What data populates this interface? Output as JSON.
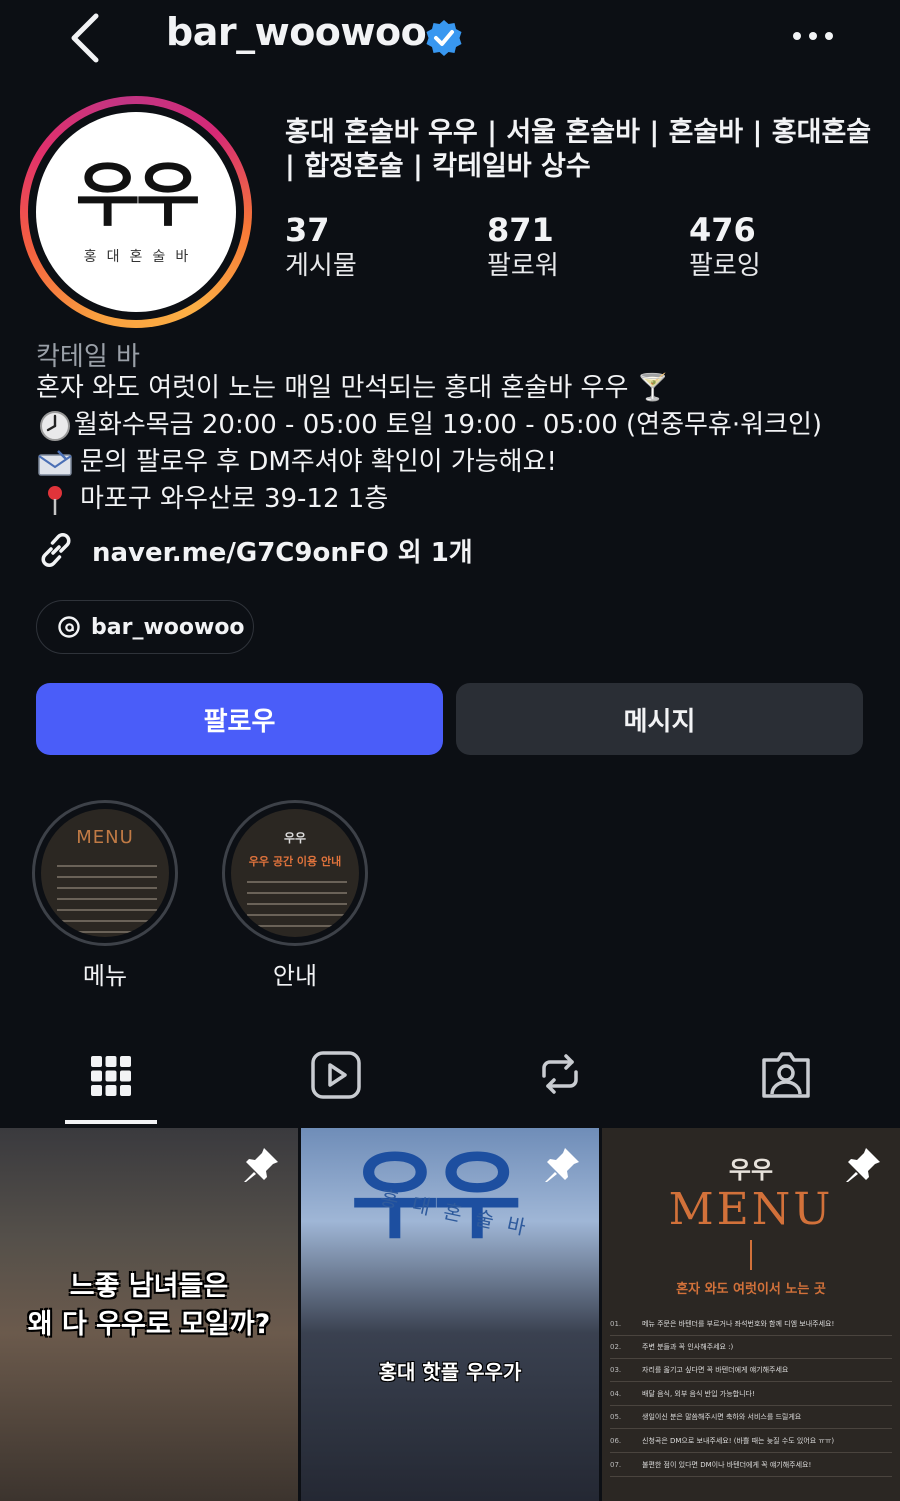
{
  "header": {
    "username": "bar_woowoo"
  },
  "profile": {
    "avatar_logo": "우우",
    "avatar_sub": "홍대혼술바",
    "full_name": "홍대 혼술바 우우 | 서울 혼술바 | 혼술바 | 홍대혼술 | 합정혼술 | 칵테일바 상수",
    "stats": [
      {
        "num": "37",
        "label": "게시물"
      },
      {
        "num": "871",
        "label": "팔로워"
      },
      {
        "num": "476",
        "label": "팔로잉"
      }
    ],
    "category": "칵테일 바",
    "bio_lines": [
      "혼자 와도 여럿이 노는 매일 만석되는 홍대 혼술바 우우 🍸",
      "월화수목금 20:00 - 05:00 토일 19:00 - 05:00 (연중무휴·워크인)",
      "문의 팔로우 후 DM주셔야 확인이 가능해요!",
      "마포구 와우산로 39-12 1층"
    ],
    "link": "naver.me/G7C9onFO 외 1개",
    "threads_handle": "bar_woowoo"
  },
  "actions": {
    "follow": "팔로우",
    "message": "메시지"
  },
  "highlights": [
    {
      "label": "메뉴",
      "cover_title": "MENU"
    },
    {
      "label": "안내",
      "cover_top": "우우",
      "cover_title": "우우 공간 이용 안내"
    }
  ],
  "posts": [
    {
      "text_line1": "느좋 남녀들은",
      "text_line2": "왜 다 우우로 모일까?",
      "pinned": true
    },
    {
      "logo": "우우",
      "sub": "홍대혼술바",
      "text": "홍대 핫플 우우가",
      "pinned": true
    },
    {
      "logo": "우우",
      "title": "MENU",
      "subtitle": "혼자 와도 여럿이서 노는 곳",
      "rows": [
        {
          "n": "01.",
          "t": "메뉴 주문은 바텐더를 부르거나 좌석번호와 함께 디엠 보내주세요!"
        },
        {
          "n": "02.",
          "t": "주변 분들과 꼭 인사해주세요 :)"
        },
        {
          "n": "03.",
          "t": "자리를 옮기고 싶다면 꼭 바텐더에게 얘기해주세요"
        },
        {
          "n": "04.",
          "t": "배달 음식, 외부 음식 반입 가능합니다!"
        },
        {
          "n": "05.",
          "t": "생일이신 분은 말씀해주시면 축하와 서비스를 드릴게요"
        },
        {
          "n": "06.",
          "t": "신청곡은 DM으로 보내주세요! (바쁠 때는 늦질 수도 있어요 ㅠㅠ)"
        },
        {
          "n": "07.",
          "t": "불편한 점이 있다면 DM이나 바텐더에게 꼭 얘기해주세요!"
        }
      ],
      "pinned": true
    }
  ],
  "colors": {
    "background": "#0c0f14",
    "follow_button": "#4a5df9",
    "message_button": "#2a2e35",
    "verified_badge": "#3897f0"
  }
}
